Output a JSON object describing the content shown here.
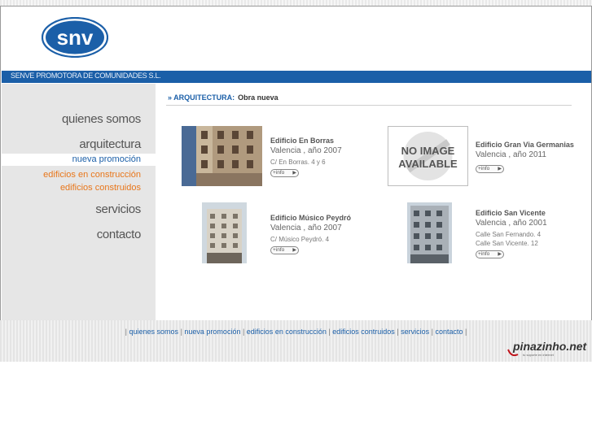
{
  "company": {
    "logo_text": "snv",
    "name_bar": "SENVE PROMOTORA DE COMUNIDADES S.L."
  },
  "sidebar": {
    "main": [
      {
        "label": "quienes somos"
      },
      {
        "label": "arquitectura"
      },
      {
        "label": "servicios"
      },
      {
        "label": "contacto"
      }
    ],
    "active_sub": "nueva promoción",
    "subs": [
      {
        "label": "edificios en construcción"
      },
      {
        "label": "edificios construidos"
      }
    ]
  },
  "breadcrumb": {
    "section": "» ARQUITECTURA:",
    "current": "Obra nueva"
  },
  "projects": [
    {
      "name": "Edificio En Borras",
      "city": "Valencia , año 2007",
      "address": [
        "C/ En Borras. 4 y 6"
      ],
      "button": "+info"
    },
    {
      "name": "Edificio Gran Via Germanias",
      "city": "Valencia , año 2011",
      "address": [],
      "button": "+info",
      "placeholder": [
        "NO IMAGE",
        "AVAILABLE"
      ]
    },
    {
      "name": "Edificio Músico Peydró",
      "city": "Valencia , año 2007",
      "address": [
        "C/ Músico Peydró. 4"
      ],
      "button": "+info"
    },
    {
      "name": "Edificio San Vicente",
      "city": "Valencia , año 2001",
      "address": [
        "Calle San Fernando. 4",
        "Calle San Vicente. 12"
      ],
      "button": "+info"
    }
  ],
  "footer": {
    "links": [
      "quienes somos",
      "nueva promoción",
      "edificios en construcción",
      "edificios contruidos",
      "servicios",
      "contacto"
    ],
    "brand": "pinazinho.net",
    "brand_tag": "tu soporte en internet"
  },
  "colors": {
    "accent": "#1b5fa8",
    "orange": "#e8761a"
  }
}
